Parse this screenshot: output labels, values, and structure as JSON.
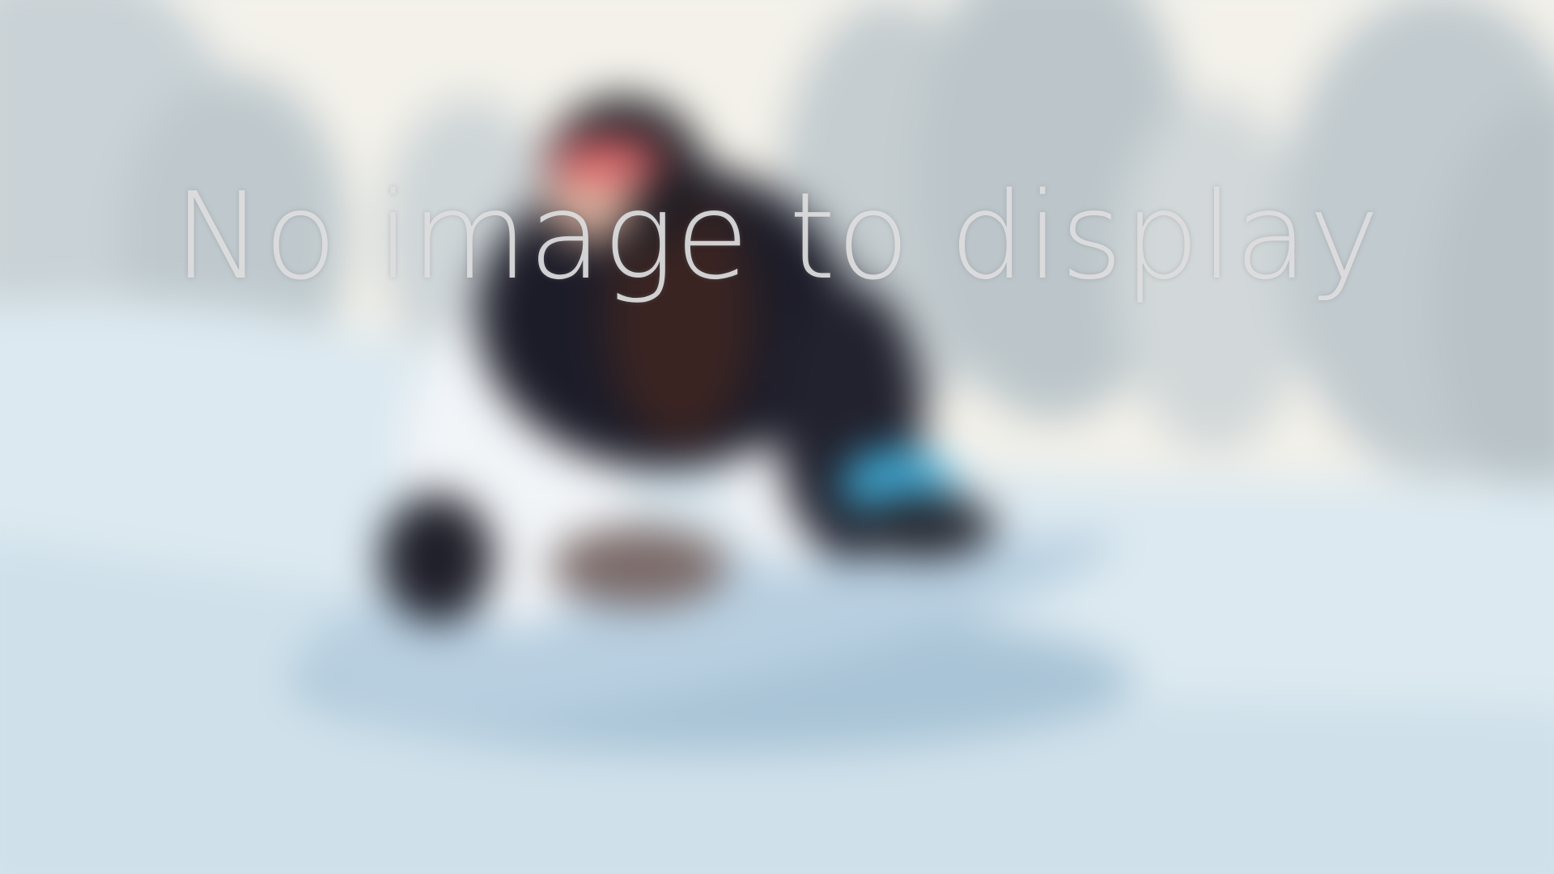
{
  "placeholder": {
    "message": "No image to display",
    "background_description_icon": "blurred-snowboarder-background",
    "text_color": "#dedee0"
  },
  "colors": {
    "sky": "#f3f1ea",
    "snow": "#dbe8ef",
    "snow_shadow": "#a9c4d6",
    "trees": "#c7cfd2",
    "jacket": "#1c1c28",
    "pants": "#f2f5f8",
    "board": "#b8cfe0",
    "goggles": "#e06a6e",
    "glove": "#3fb0dc"
  }
}
